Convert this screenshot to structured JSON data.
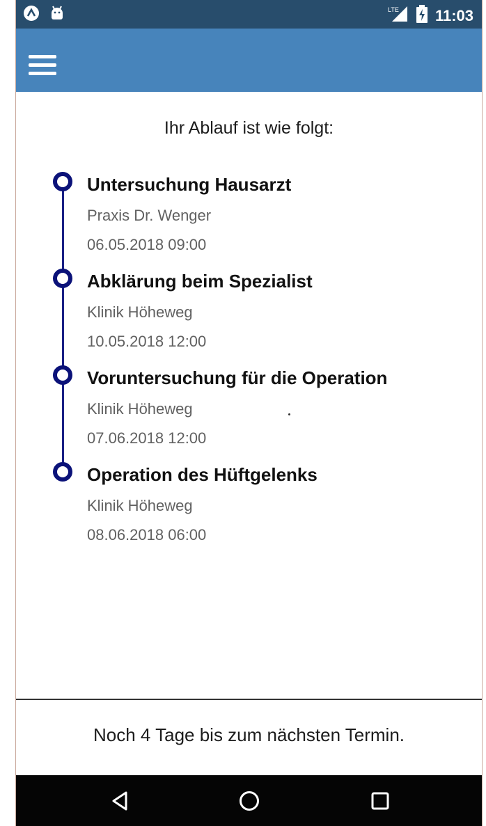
{
  "status_bar": {
    "time": "11:03",
    "network": "LTE",
    "icons": [
      "app-a-icon",
      "android-icon",
      "lte-signal-icon",
      "battery-charging-icon"
    ]
  },
  "app_bar": {
    "menu_icon": "hamburger-menu-icon",
    "color": "#4784bb"
  },
  "timeline": {
    "heading": "Ihr Ablauf ist wie folgt:",
    "accent_color": "#0b1279",
    "items": [
      {
        "title": "Untersuchung Hausarzt",
        "place": "Praxis Dr. Wenger",
        "datetime": "06.05.2018 09:00"
      },
      {
        "title": "Abklärung beim Spezialist",
        "place": "Klinik Höheweg",
        "datetime": "10.05.2018 12:00"
      },
      {
        "title": "Voruntersuchung für die Operation",
        "place": "Klinik Höheweg",
        "datetime": "07.06.2018 12:00"
      },
      {
        "title": "Operation des Hüftgelenks",
        "place": "Klinik Höheweg",
        "datetime": "08.06.2018 06:00"
      }
    ]
  },
  "footer": {
    "text": "Noch 4 Tage bis zum nächsten Termin."
  },
  "nav_bar": {
    "buttons": [
      "back-icon",
      "home-icon",
      "recents-icon"
    ]
  }
}
